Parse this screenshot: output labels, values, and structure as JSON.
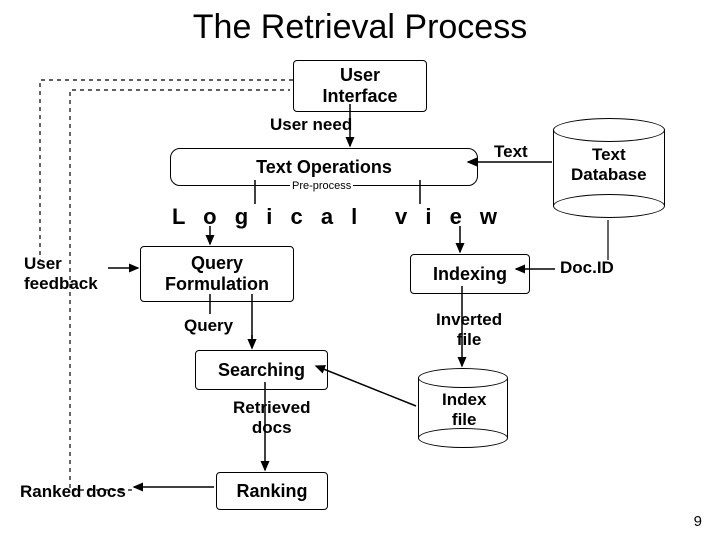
{
  "title": "The Retrieval Process",
  "boxes": {
    "user_interface": "User\nInterface",
    "text_operations": "Text   Operations",
    "query_formulation": "Query\nFormulation",
    "indexing": "Indexing",
    "searching": "Searching",
    "ranking": "Ranking"
  },
  "labels": {
    "user_need": "User need",
    "text_arrow": "Text",
    "pre_process": "Pre-process",
    "logical": "L o g i c a l",
    "view": "v i e w",
    "user_feedback": "User\nfeedback",
    "doc_id": "Doc.ID",
    "query": "Query",
    "inverted_file": "Inverted\nfile",
    "retrieved_docs": "Retrieved\ndocs",
    "ranked_docs": "Ranked docs",
    "text_database": "Text\nDatabase",
    "index_file": "Index\nfile",
    "page": "9"
  }
}
